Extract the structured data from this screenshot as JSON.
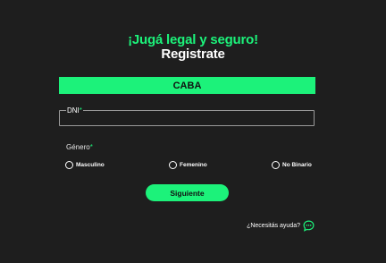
{
  "header": {
    "headline": "¡Jugá legal y seguro!",
    "title": "Registrate"
  },
  "region": {
    "label": "CABA"
  },
  "dni": {
    "label": "DNI",
    "required_mark": "*",
    "value": ""
  },
  "gender": {
    "label": "Género",
    "required_mark": "*",
    "options": [
      "Masculino",
      "Femenino",
      "No Binario"
    ]
  },
  "submit": {
    "label": "Siguiente"
  },
  "help": {
    "text": "¿Necesitás ayuda?",
    "icon": "chat-bubble-icon"
  },
  "colors": {
    "accent": "#1cf27a",
    "background": "#1e1e1e"
  }
}
